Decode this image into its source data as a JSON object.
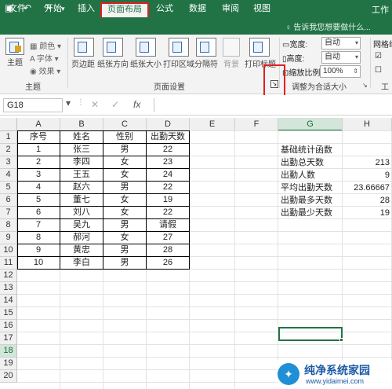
{
  "titlebar": {
    "title": "工作",
    "save_icon": "save-icon",
    "undo": "↶",
    "redo": "↷"
  },
  "tabs": [
    {
      "label": "文件"
    },
    {
      "label": "开始"
    },
    {
      "label": "插入"
    },
    {
      "label": "页面布局",
      "active": true
    },
    {
      "label": "公式"
    },
    {
      "label": "数据"
    },
    {
      "label": "审阅"
    },
    {
      "label": "视图"
    }
  ],
  "tell_me": "告诉我您想要做什么...",
  "ribbon": {
    "theme_group_label": "主题",
    "theme_button": "主题",
    "theme_colors": "颜色",
    "theme_fonts": "字体",
    "theme_effects": "效果",
    "page_setup_label": "页面设置",
    "margins": "页边距",
    "orientation": "纸张方向",
    "size": "纸张大小",
    "print_area": "打印区域",
    "breaks": "分隔符",
    "background": "背景",
    "print_titles": "打印标题",
    "scale_group_label": "调整为合适大小",
    "width_label": "宽度:",
    "width_value": "自动",
    "height_label": "高度:",
    "height_value": "自动",
    "scale_label": "缩放比例:",
    "scale_value": "100%",
    "gridlines": "网格线",
    "sheet_options_short": "工"
  },
  "formula_bar": {
    "name_box": "G18",
    "cancel": "✕",
    "enter": "✓",
    "fx": "fx",
    "content": ""
  },
  "columns": [
    "A",
    "B",
    "C",
    "D",
    "E",
    "F",
    "G",
    "H"
  ],
  "rows": [
    "1",
    "2",
    "3",
    "4",
    "5",
    "6",
    "7",
    "8",
    "9",
    "10",
    "11",
    "12",
    "13",
    "14",
    "15",
    "16",
    "17",
    "18",
    "19",
    "20"
  ],
  "table": {
    "headers": [
      "序号",
      "姓名",
      "性别",
      "出勤天数"
    ],
    "rows": [
      [
        "1",
        "张三",
        "男",
        "22"
      ],
      [
        "2",
        "李四",
        "女",
        "23"
      ],
      [
        "3",
        "王五",
        "女",
        "24"
      ],
      [
        "4",
        "赵六",
        "男",
        "22"
      ],
      [
        "5",
        "董七",
        "女",
        "19"
      ],
      [
        "6",
        "刘八",
        "女",
        "22"
      ],
      [
        "7",
        "吴九",
        "男",
        "请假"
      ],
      [
        "8",
        "郝河",
        "女",
        "27"
      ],
      [
        "9",
        "黄忠",
        "男",
        "28"
      ],
      [
        "10",
        "李白",
        "男",
        "26"
      ]
    ]
  },
  "stats": {
    "heading": "基础统计函数",
    "items": [
      {
        "label": "出勤总天数",
        "value": "213"
      },
      {
        "label": "出勤人数",
        "value": "9"
      },
      {
        "label": "平均出勤天数",
        "value": "23.66667"
      },
      {
        "label": "出勤最多天数",
        "value": "28"
      },
      {
        "label": "出勤最少天数",
        "value": "19"
      }
    ]
  },
  "watermark": {
    "title": "纯净系统家园",
    "url": "www.yidaimei.com"
  }
}
